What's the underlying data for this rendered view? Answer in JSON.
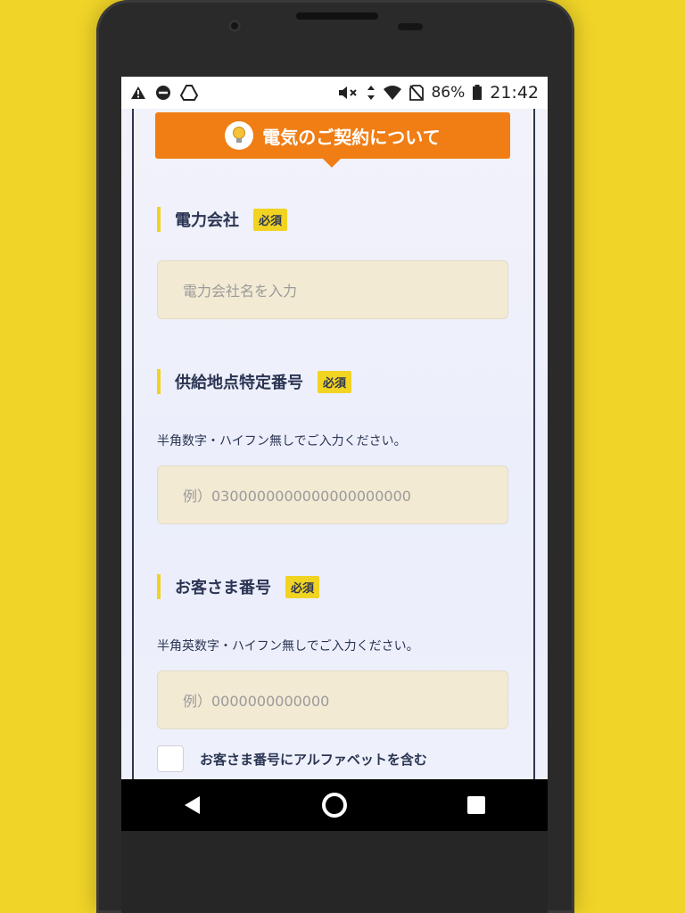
{
  "status_bar": {
    "battery_percent": "86%",
    "time": "21:42",
    "left_icons": [
      "warning-icon",
      "do-not-disturb-icon",
      "drive-icon"
    ],
    "right_icons": [
      "mute-icon",
      "data-arrows-icon",
      "wifi-icon",
      "no-sim-icon",
      "battery-icon"
    ]
  },
  "form": {
    "section_title": "電気のご契約について",
    "section_icon": "lightbulb-icon",
    "required_badge": "必須",
    "power_company": {
      "label": "電力会社",
      "placeholder": "電力会社名を入力"
    },
    "supply_point": {
      "label": "供給地点特定番号",
      "help": "半角数字・ハイフン無しでご入力ください。",
      "placeholder": "例）0300000000000000000000"
    },
    "customer_number": {
      "label": "お客さま番号",
      "help": "半角英数字・ハイフン無しでご入力ください。",
      "placeholder": "例）0000000000000"
    },
    "alphabet_checkbox": {
      "label": "お客さま番号にアルファベットを含む",
      "checked": false
    }
  },
  "nav_bar": {
    "icons": [
      "back-icon",
      "home-icon",
      "recents-icon"
    ]
  },
  "colors": {
    "background": "#f0d428",
    "banner": "#f07e14",
    "accent": "#f1d322",
    "text": "#2b3553",
    "field": "#f3ead4"
  }
}
